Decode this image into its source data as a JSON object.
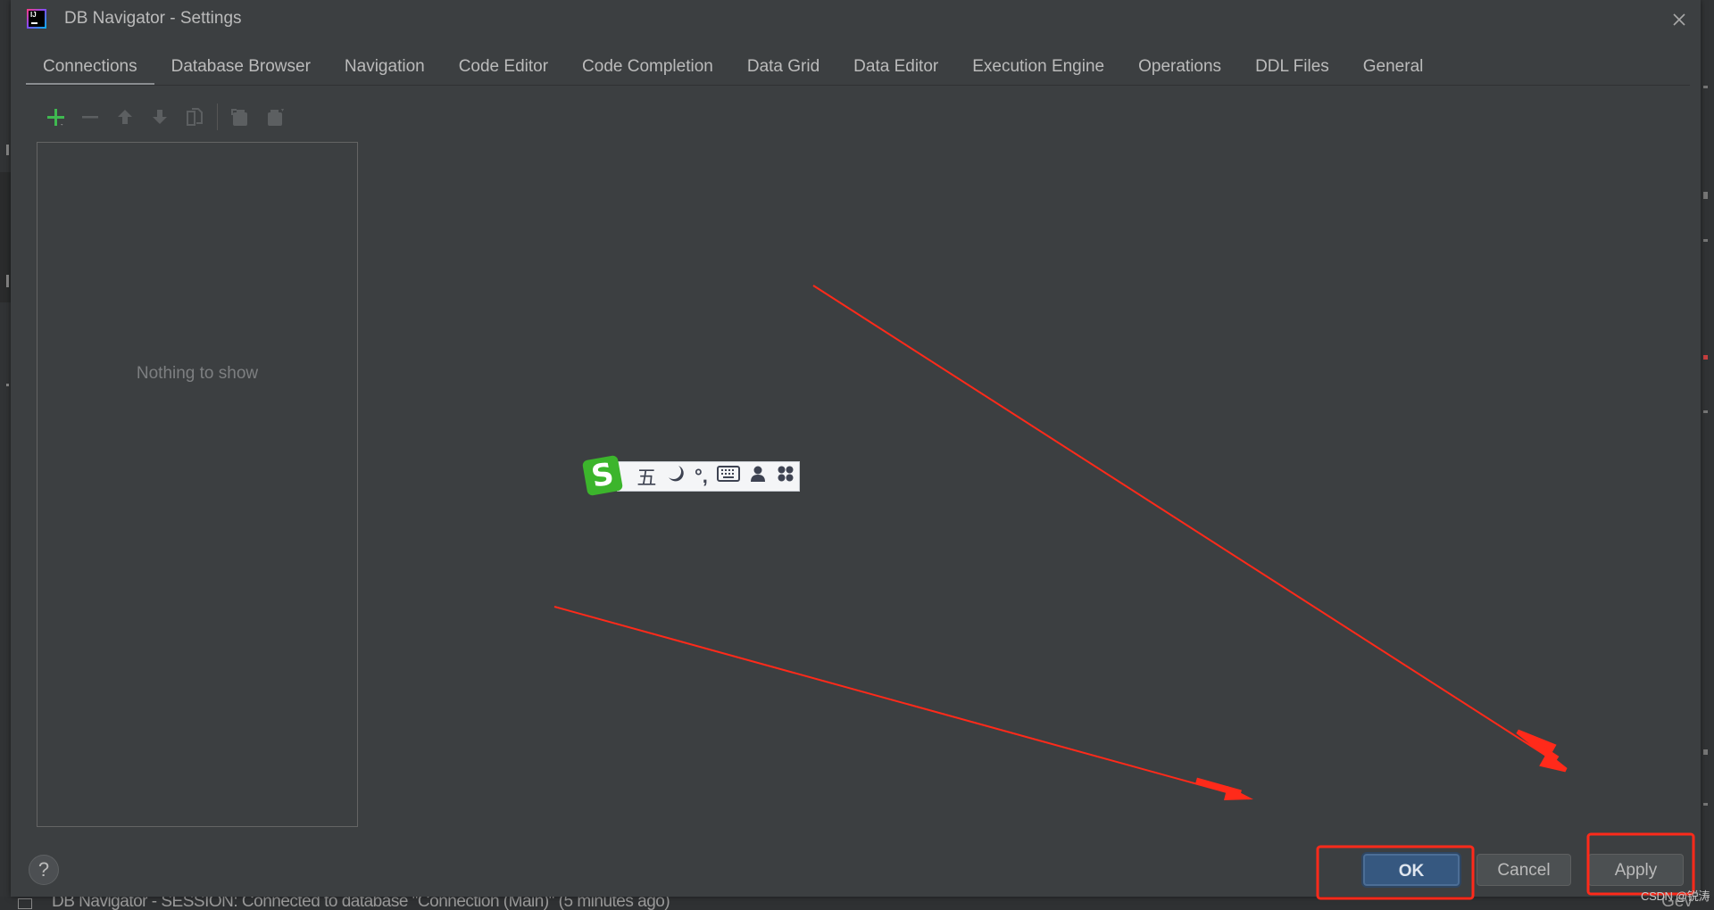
{
  "dialog": {
    "title": "DB Navigator - Settings",
    "close_icon": "close-icon"
  },
  "tabs": [
    {
      "label": "Connections",
      "active": true
    },
    {
      "label": "Database Browser",
      "active": false
    },
    {
      "label": "Navigation",
      "active": false
    },
    {
      "label": "Code Editor",
      "active": false
    },
    {
      "label": "Code Completion",
      "active": false
    },
    {
      "label": "Data Grid",
      "active": false
    },
    {
      "label": "Data Editor",
      "active": false
    },
    {
      "label": "Execution Engine",
      "active": false
    },
    {
      "label": "Operations",
      "active": false
    },
    {
      "label": "DDL Files",
      "active": false
    },
    {
      "label": "General",
      "active": false
    }
  ],
  "toolbar": {
    "icons": [
      "add-icon",
      "remove-icon",
      "move-up-icon",
      "move-down-icon",
      "duplicate-icon",
      "copy-to-clipboard-icon",
      "paste-from-clipboard-icon"
    ],
    "accent": "#3fb950"
  },
  "connections_list": {
    "empty_text": "Nothing to show"
  },
  "ime": {
    "logo": "S",
    "mode": "五",
    "icons": [
      "moon-icon",
      "punctuation-icon",
      "keyboard-icon",
      "user-icon",
      "apps-icon"
    ],
    "punct": "°,"
  },
  "footer": {
    "help_label": "?",
    "ok_label": "OK",
    "cancel_label": "Cancel",
    "apply_label": "Apply"
  },
  "background": {
    "status_text": "DB Navigator - SESSION: Connected to database \"Connection (Main)\" (5 minutes ago)",
    "status_right": "Gev"
  },
  "annotation": {
    "color": "#ff2a1a",
    "watermark": "CSDN @锐涛"
  }
}
